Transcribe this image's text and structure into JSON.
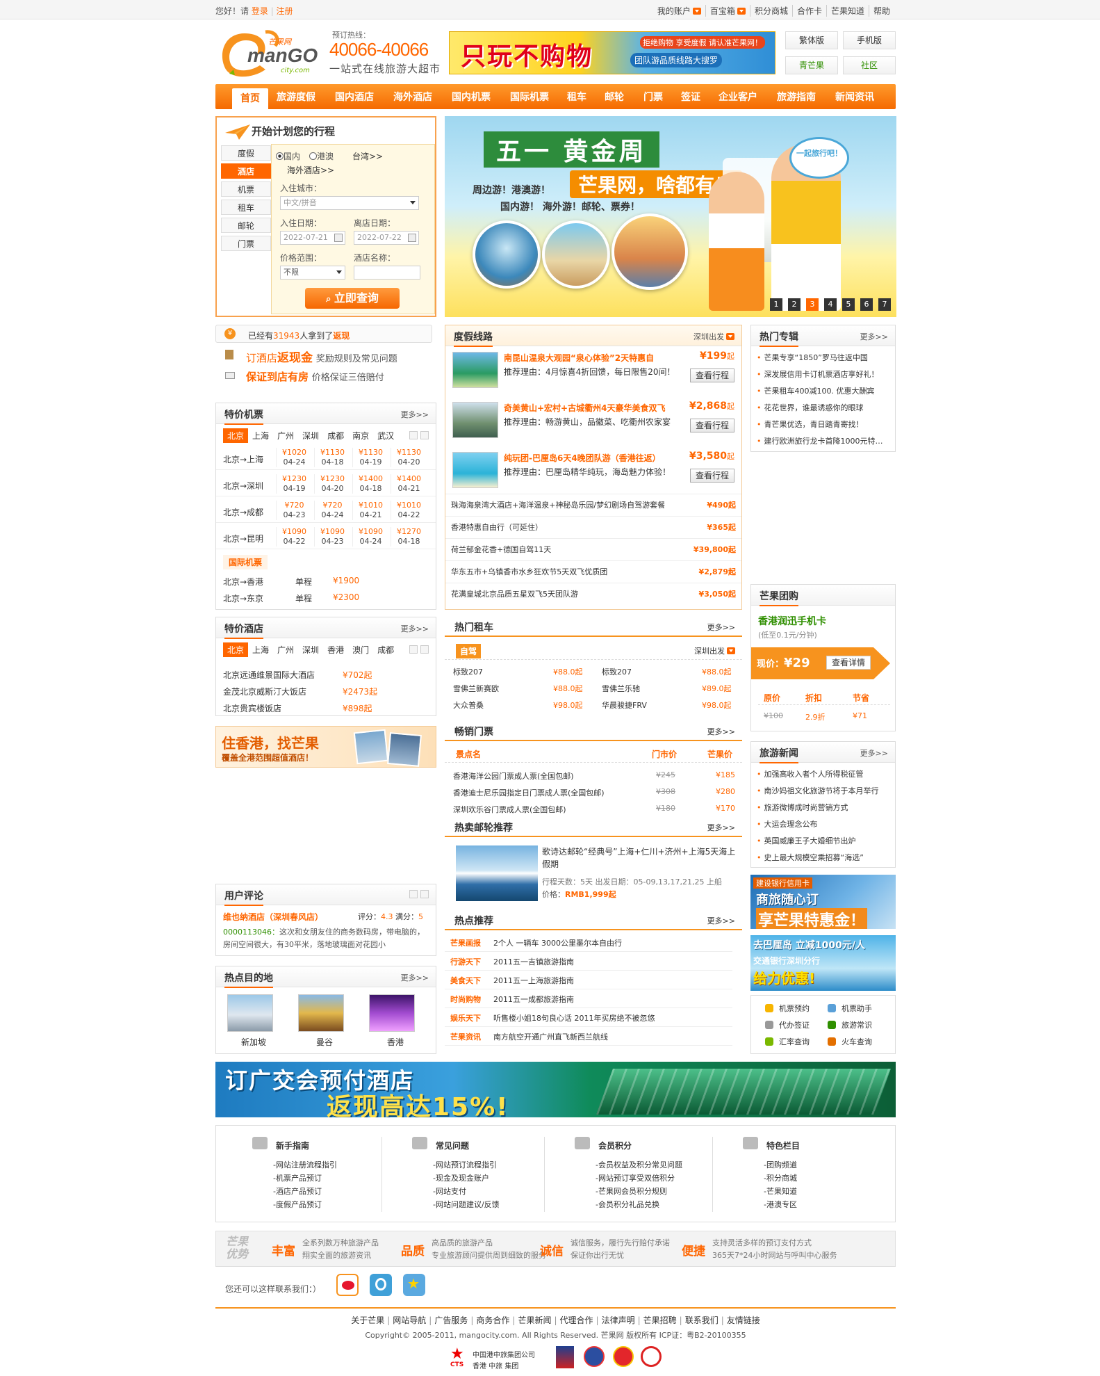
{
  "topbar": {
    "greeting": "您好！请",
    "login": "登录",
    "register": "注册",
    "links": [
      "我的账户",
      "百宝箱",
      "积分商城",
      "合作卡",
      "芒果知道",
      "帮助"
    ]
  },
  "header": {
    "logo_cn": "芒果网",
    "logo_en": "manGO",
    "logo_domain": "city.com",
    "hotline_label": "预订热线：",
    "hotline": "40066-40066",
    "slogan": "一站式在线旅游大超市",
    "ad_big": "只玩不购物",
    "ad_small1": "拒绝购物 享受度假 请认准芒果网！",
    "ad_small2": "团队游品质线路大搜罗",
    "buttons": [
      "繁体版",
      "手机版",
      "青芒果",
      "社区"
    ]
  },
  "nav": [
    "首页",
    "旅游度假",
    "国内酒店",
    "海外酒店",
    "国内机票",
    "国际机票",
    "租车",
    "邮轮",
    "门票",
    "签证",
    "企业客户",
    "旅游指南",
    "新闻资讯"
  ],
  "search": {
    "title": "开始计划您的行程",
    "tabs": [
      "度假",
      "酒店",
      "机票",
      "租车",
      "邮轮",
      "门票"
    ],
    "active_tab": "酒店",
    "radio_domestic": "国内",
    "radio_hk": "港澳",
    "taiwan": "台湾>>",
    "overseas": "海外酒店>>",
    "city_label": "入住城市：",
    "city_placeholder": "中文/拼音",
    "checkin_label": "入住日期：",
    "checkout_label": "离店日期：",
    "checkin": "2022-07-21",
    "checkout": "2022-07-22",
    "price_label": "价格范围：",
    "hotel_label": "酒店名称：",
    "price_value": "不限",
    "submit": "立即查询"
  },
  "banner": {
    "title": "五一 黄金周",
    "subtitle": "芒果网，啥都有！",
    "line1": "周边游！港澳游！",
    "line2": "国内游！ 海外游！邮轮、票券！",
    "bubble": "一起旅行吧！",
    "pages": [
      "1",
      "2",
      "3",
      "4",
      "5",
      "6",
      "7"
    ],
    "active_page": "3"
  },
  "cashback": {
    "l1a": "已经有",
    "count": "31943",
    "l1b": "人拿到了",
    "l1c": "返现",
    "l2a": "订酒店",
    "l2b": "返现金",
    "l2c": "奖励规则及常见问题",
    "l3a": "保证到店有房",
    "l3b": "价格保证三倍赔付"
  },
  "flights": {
    "title": "特价机票",
    "more": "更多>>",
    "cities": [
      "北京",
      "上海",
      "广州",
      "深圳",
      "成都",
      "南京",
      "武汉"
    ],
    "routes": [
      {
        "route": "北京→上海",
        "fares": [
          [
            "¥1020",
            "04-24"
          ],
          [
            "¥1130",
            "04-18"
          ],
          [
            "¥1130",
            "04-19"
          ],
          [
            "¥1130",
            "04-20"
          ]
        ]
      },
      {
        "route": "北京→深圳",
        "fares": [
          [
            "¥1230",
            "04-19"
          ],
          [
            "¥1230",
            "04-20"
          ],
          [
            "¥1400",
            "04-18"
          ],
          [
            "¥1400",
            "04-21"
          ]
        ]
      },
      {
        "route": "北京→成都",
        "fares": [
          [
            "¥720",
            "04-23"
          ],
          [
            "¥720",
            "04-24"
          ],
          [
            "¥1010",
            "04-21"
          ],
          [
            "¥1010",
            "04-22"
          ]
        ]
      },
      {
        "route": "北京→昆明",
        "fares": [
          [
            "¥1090",
            "04-22"
          ],
          [
            "¥1090",
            "04-23"
          ],
          [
            "¥1090",
            "04-24"
          ],
          [
            "¥1270",
            "04-18"
          ]
        ]
      }
    ],
    "intl_label": "国际机票",
    "intl": [
      {
        "route": "北京→香港",
        "type": "单程",
        "price": "¥1900"
      },
      {
        "route": "北京→东京",
        "type": "单程",
        "price": "¥2300"
      }
    ]
  },
  "hotels": {
    "title": "特价酒店",
    "more": "更多>>",
    "cities": [
      "北京",
      "上海",
      "广州",
      "深圳",
      "香港",
      "澳门",
      "成都"
    ],
    "items": [
      {
        "name": "北京远通维景国际大酒店",
        "price": "¥702起"
      },
      {
        "name": "金茂北京威斯汀大饭店",
        "price": "¥2473起"
      },
      {
        "name": "北京贵宾楼饭店",
        "price": "¥898起"
      }
    ],
    "ad_title": "住香港，找芒果",
    "ad_sub": "覆盖全港范围超值酒店！"
  },
  "reviews": {
    "title": "用户评论",
    "hotel": "维也纳酒店（深圳春风店）",
    "score_label": "评分：",
    "score": "4.3",
    "full_label": "满分：",
    "full": "5",
    "user": "0000113046：",
    "text": "这次和女朋友住的商务数码房，带电脑的，房间空间很大，有30平米，落地玻璃面对花园小"
  },
  "destinations": {
    "title": "热点目的地",
    "more": "更多>>",
    "items": [
      "新加坡",
      "曼谷",
      "香港"
    ]
  },
  "vacation": {
    "title": "度假线路",
    "depart": "深圳出发",
    "featured": [
      {
        "title": "南昆山温泉大观园“泉心体验”2天特惠自",
        "reason_label": "推荐理由：",
        "reason": "4月惊喜4折回馈，每日限售20间！",
        "price": "¥199",
        "suffix": "起",
        "btn": "查看行程"
      },
      {
        "title": "奇美黄山+宏村+古城衢州4天豪华美食双飞",
        "reason_label": "推荐理由：",
        "reason": "畅游黄山，品徽菜、吃衢州农家宴",
        "price": "¥2,868",
        "suffix": "起",
        "btn": "查看行程"
      },
      {
        "title": "纯玩团-巴厘岛6天4晚团队游（香港往返）",
        "reason_label": "推荐理由：",
        "reason": "巴厘岛精华纯玩，海岛魅力体验！",
        "price": "¥3,580",
        "suffix": "起",
        "btn": "查看行程"
      }
    ],
    "list": [
      {
        "name": "珠海海泉湾大酒店+海洋温泉+神秘岛乐园/梦幻剧场自驾游套餐",
        "price": "¥490起"
      },
      {
        "name": "香港特惠自由行（可延住）",
        "price": "¥365起"
      },
      {
        "name": "荷兰郁金花香+德国自驾11天",
        "price": "¥39,800起"
      },
      {
        "name": "华东五市+乌镇香市水乡狂欢节5天双飞优质团",
        "price": "¥2,879起"
      },
      {
        "name": "花满皇城北京品质五星双飞5天团队游",
        "price": "¥3,050起"
      }
    ]
  },
  "carrental": {
    "title": "热门租车",
    "more": "更多>>",
    "tab": "自驾",
    "depart": "深圳出发",
    "left": [
      [
        "标致207",
        "¥88.0起"
      ],
      [
        "雪佛兰新赛欧",
        "¥88.0起"
      ],
      [
        "大众普桑",
        "¥98.0起"
      ]
    ],
    "right": [
      [
        "标致207",
        "¥88.0起"
      ],
      [
        "雪佛兰乐驰",
        "¥89.0起"
      ],
      [
        "华晨骏捷FRV",
        "¥98.0起"
      ]
    ]
  },
  "tickets": {
    "title": "畅销门票",
    "more": "更多>>",
    "h_spot": "景点名",
    "h_door": "门市价",
    "h_mango": "芒果价",
    "items": [
      {
        "name": "香港海洋公园门票成人票(全国包邮)",
        "door": "¥245",
        "price": "¥185"
      },
      {
        "name": "香港迪士尼乐园指定日门票成人票(全国包邮)",
        "door": "¥308",
        "price": "¥280"
      },
      {
        "name": "深圳欢乐谷门票成人票(全国包邮)",
        "door": "¥180",
        "price": "¥170"
      }
    ]
  },
  "cruise": {
    "title": "热卖邮轮推荐",
    "more": "更多>>",
    "name": "歌诗达邮轮“经典号”上海+仁川+济州+上海5天海上假期",
    "days": "行程天数：5天",
    "dates": "出发日期：05-09,13,17,21,25 上船",
    "price_label": "价格：",
    "price": "RMB1,999起"
  },
  "hotnews": {
    "title": "热点推荐",
    "more": "更多>>",
    "items": [
      {
        "tag": "芒果画报",
        "text": "2个人 一辆车 3000公里墨尔本自由行"
      },
      {
        "tag": "行游天下",
        "text": "2011五一吉镇旅游指南"
      },
      {
        "tag": "美食天下",
        "text": "2011五一上海旅游指南"
      },
      {
        "tag": "时尚购物",
        "text": "2011五一成都旅游指南"
      },
      {
        "tag": "娱乐天下",
        "text": "听售楼小姐18句良心话 2011年买房绝不被忽悠"
      },
      {
        "tag": "芒果资讯",
        "text": "南方航空开通广州直飞新西兰航线"
      }
    ]
  },
  "specials": {
    "title": "热门专辑",
    "more": "更多>>",
    "items": [
      "芒果专享“1850”罗马往返中国",
      "深发展信用卡订机票酒店享好礼！",
      "芒果租车400减100. 优惠大酬宾",
      "花花世界，谁最诱惑你的眼球",
      "青芒果优选，青日踏青寄找！",
      "建行欧洲旅行龙卡首降1000元特…"
    ]
  },
  "groupbuy": {
    "title": "芒果团购",
    "product": "香港润迅手机卡",
    "note": "(低至0.1元/分钟)",
    "now_label": "现价：",
    "now": "¥29",
    "btn": "查看详情",
    "h1": "原价",
    "h2": "折扣",
    "h3": "节省",
    "v1": "¥100",
    "v2": "2.9折",
    "v3": "¥71"
  },
  "travelnews": {
    "title": "旅游新闻",
    "more": "更多>>",
    "items": [
      "加强高收入者个人所得税征管",
      "南沙妈祖文化旅游节将于本月举行",
      "旅游微博成时尚营销方式",
      "大运会理念公布",
      "英国威廉王子大婚细节出炉",
      "史上最大规模空乘招募“海选”"
    ]
  },
  "sidead1": {
    "t1": "建设银行信用卡",
    "t2": "商旅随心订",
    "t3": "享芒果特惠金！"
  },
  "sidead2": {
    "t1": "去巴厘岛 立减1000元/人",
    "t2": "交通银行深圳分行",
    "t3": "给力优惠!"
  },
  "tools": [
    "机票预约",
    "机票助手",
    "代办签证",
    "旅游常识",
    "汇率查询",
    "火车查询"
  ],
  "bigad": {
    "t1": "订广交会预付酒店",
    "t2": "返现高达15%!"
  },
  "footer_help": [
    {
      "title": "新手指南",
      "items": [
        "-网站注册流程指引",
        "-机票产品预订",
        "-酒店产品预订",
        "-度假产品预订"
      ]
    },
    {
      "title": "常见问题",
      "items": [
        "-网站预订流程指引",
        "-现金及现金账户",
        "-网站支付",
        "-网站问题建议/反馈"
      ]
    },
    {
      "title": "会员积分",
      "items": [
        "-会员权益及积分常见问题",
        "-网站预订享受双倍积分",
        "-芒果网会员积分规则",
        "-会员积分礼品兑换"
      ]
    },
    {
      "title": "特色栏目",
      "items": [
        "-团购频道",
        "-积分商城",
        "-芒果知道",
        "-港澳专区"
      ]
    }
  ],
  "advantage": {
    "label1": "芒果",
    "label2": "优势",
    "items": [
      {
        "h": "丰富",
        "l1": "全系列数万种旅游产品",
        "l2": "翔实全面的旅游资讯"
      },
      {
        "h": "品质",
        "l1": "高品质的旅游产品",
        "l2": "专业旅游顾问提供周到细致的服务"
      },
      {
        "h": "诚信",
        "l1": "诚信服务，履行先行赔付承诺",
        "l2": "保证你出行无忧"
      },
      {
        "h": "便捷",
        "l1": "支持灵活多样的预订支付方式",
        "l2": "365天7*24小时网站与呼叫中心服务"
      }
    ]
  },
  "contact": "您还可以这样联系我们：）",
  "footlinks": [
    "关于芒果",
    "网站导航",
    "广告服务",
    "商务合作",
    "芒果新闻",
    "代理合作",
    "法律声明",
    "芒果招聘",
    "联系我们",
    "友情链接"
  ],
  "copyright": "Copyright© 2005-2011, mangocity.com. All Rights Reserved. 芒果网 版权所有    ICP证：粤B2-20100355",
  "group_cn": "中国港中旅集团公司",
  "group_cts": "CTS",
  "group_sub": "香港 中旅 集团",
  "colors": {
    "accent": "#f60",
    "nav": "#f77d0a"
  }
}
